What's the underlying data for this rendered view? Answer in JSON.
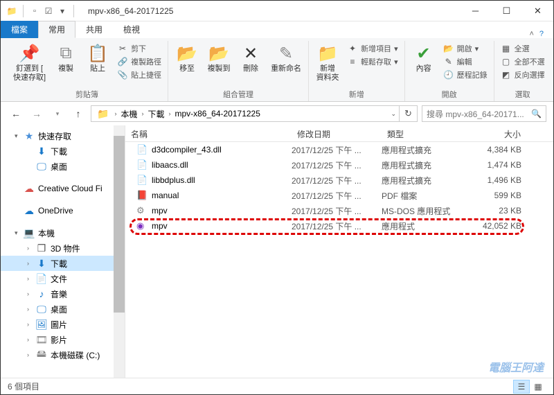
{
  "title": "mpv-x86_64-20171225",
  "tabs": {
    "file": "檔案",
    "home": "常用",
    "share": "共用",
    "view": "檢視"
  },
  "ribbon": {
    "pin": "釘選到 [\n快速存取]",
    "copy": "複製",
    "paste": "貼上",
    "cut": "剪下",
    "copypath": "複製路徑",
    "pasteshortcut": "貼上捷徑",
    "clipboard_label": "剪貼簿",
    "moveto": "移至",
    "copyto": "複製到",
    "delete": "刪除",
    "rename": "重新命名",
    "organize_label": "組合管理",
    "newfolder": "新增\n資料夾",
    "newitem": "新增項目",
    "easyaccess": "輕鬆存取",
    "new_label": "新增",
    "properties": "內容",
    "open": "開啟",
    "edit": "編輯",
    "history": "歷程記錄",
    "open_label": "開啟",
    "selectall": "全選",
    "selectnone": "全部不選",
    "invertsel": "反向選擇",
    "select_label": "選取"
  },
  "breadcrumb": [
    "本機",
    "下載",
    "mpv-x86_64-20171225"
  ],
  "search_placeholder": "搜尋 mpv-x86_64-20171...",
  "nav": {
    "quick": "快速存取",
    "downloads": "下載",
    "desktop": "桌面",
    "ccf": "Creative Cloud Fi",
    "onedrive": "OneDrive",
    "thispc": "本機",
    "objects3d": "3D 物件",
    "downloads2": "下載",
    "documents": "文件",
    "music": "音樂",
    "desktop2": "桌面",
    "pictures": "圖片",
    "videos": "影片",
    "localdisk": "本機磁碟 (C:)"
  },
  "columns": {
    "name": "名稱",
    "date": "修改日期",
    "type": "類型",
    "size": "大小"
  },
  "files": [
    {
      "icon": "📄",
      "name": "d3dcompiler_43.dll",
      "date": "2017/12/25 下午 ...",
      "type": "應用程式擴充",
      "size": "4,384 KB"
    },
    {
      "icon": "📄",
      "name": "libaacs.dll",
      "date": "2017/12/25 下午 ...",
      "type": "應用程式擴充",
      "size": "1,474 KB"
    },
    {
      "icon": "📄",
      "name": "libbdplus.dll",
      "date": "2017/12/25 下午 ...",
      "type": "應用程式擴充",
      "size": "1,496 KB"
    },
    {
      "icon": "📕",
      "name": "manual",
      "date": "2017/12/25 下午 ...",
      "type": "PDF 檔案",
      "size": "599 KB"
    },
    {
      "icon": "⚙",
      "name": "mpv",
      "date": "2017/12/25 下午 ...",
      "type": "MS-DOS 應用程式",
      "size": "23 KB"
    },
    {
      "icon": "◉",
      "name": "mpv",
      "date": "2017/12/25 下午 ...",
      "type": "應用程式",
      "size": "42,052 KB"
    }
  ],
  "status": "6 個項目",
  "watermark": "電腦王阿達"
}
